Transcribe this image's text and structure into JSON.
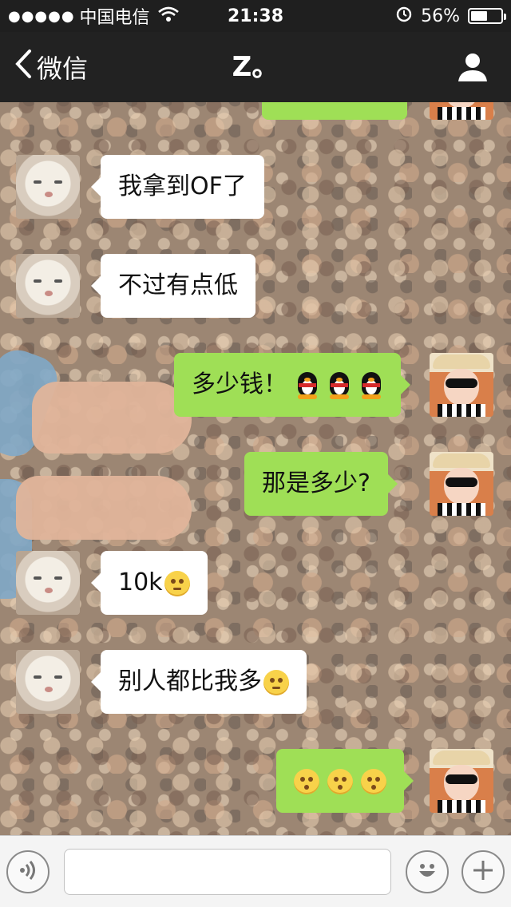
{
  "status_bar": {
    "signal": "●●●●●",
    "carrier": "中国电信",
    "wifi_icon": "wifi-icon",
    "time": "21:38",
    "alarm_icon": "alarm-icon",
    "battery_percent": "56%",
    "battery_level": 0.56
  },
  "nav": {
    "back_label": "微信",
    "title": "Z。",
    "profile_icon": "person-icon"
  },
  "messages": [
    {
      "side": "right",
      "text": "",
      "partial": true
    },
    {
      "side": "left",
      "text": "我拿到OF了"
    },
    {
      "side": "left",
      "text": "不过有点低"
    },
    {
      "side": "right",
      "text": "多少钱！",
      "emoji": [
        "penguin",
        "penguin",
        "penguin"
      ]
    },
    {
      "side": "right",
      "text": "那是多少?"
    },
    {
      "side": "left",
      "text": "10k",
      "emoji": [
        "embarrassed-smiley"
      ]
    },
    {
      "side": "left",
      "text": "别人都比我多",
      "emoji": [
        "embarrassed-smiley"
      ]
    },
    {
      "side": "right",
      "text": "",
      "emoji": [
        "kiss-smiley",
        "kiss-smiley",
        "kiss-smiley"
      ]
    }
  ],
  "input_bar": {
    "voice_icon": "voice-icon",
    "placeholder": "",
    "emoji_icon": "emoji-icon",
    "plus_icon": "plus-icon"
  },
  "colors": {
    "nav_bg": "#222222",
    "bubble_sent": "#9fdf56",
    "bubble_received": "#ffffff"
  }
}
